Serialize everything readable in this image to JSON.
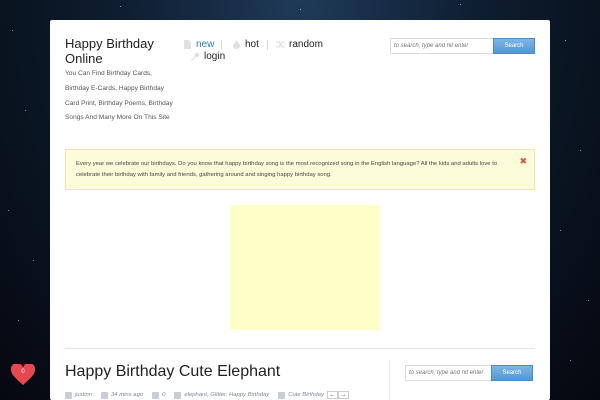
{
  "site": {
    "title": "Happy Birthday Online",
    "tagline": "You Can Find Birthday Cards, Birthday E-Cards, Happy Birthday Card Print, Birthday Poems, Birthday Songs And Many More On This Site"
  },
  "nav": {
    "items": [
      {
        "label": "new",
        "icon": "new-icon",
        "active": true
      },
      {
        "label": "hot",
        "icon": "flame-icon"
      },
      {
        "label": "random",
        "icon": "shuffle-icon"
      },
      {
        "label": "login",
        "icon": "key-icon"
      }
    ]
  },
  "search": {
    "placeholder": "to search, type and hit enter",
    "button_label": "Search"
  },
  "sidebar_search": {
    "placeholder": "to search, type and hit enter",
    "button_label": "Search"
  },
  "notice": {
    "text": "Every year we celebrate our birthdays. Do you know that happy birthday song is the most recognized song in the English language? All the kids and adults love to celebrate their birthday with family and friends, gathering around and singing happy birthday song.",
    "close_icon": "close-icon"
  },
  "post": {
    "title": "Happy Birthday Cute Elephant",
    "author": "justinn",
    "time": "34 mins ago",
    "comments": "0",
    "tags": "elephant, Glitter, Happy Birthday",
    "category": "Cute Birthday",
    "prev_icon": "←",
    "next_icon": "→"
  },
  "likes": {
    "count": "0"
  },
  "colors": {
    "accent": "#2a7bbd",
    "notice_bg": "#fdfcd9",
    "ad_bg": "#fefec7",
    "heart": "#e8474f"
  }
}
